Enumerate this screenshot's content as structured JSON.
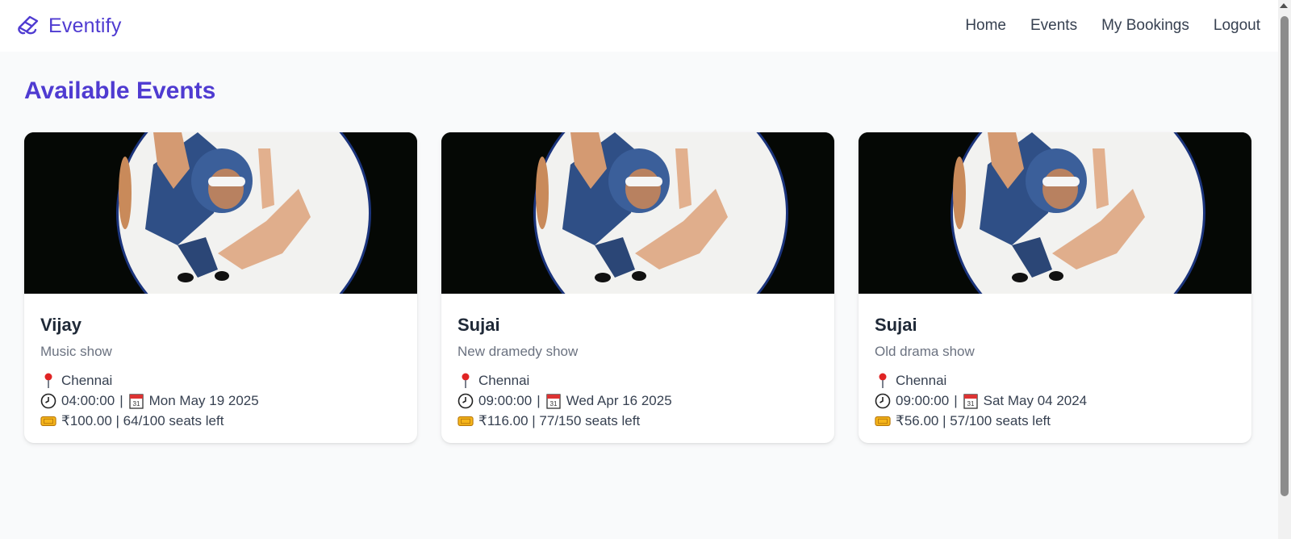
{
  "brand": {
    "name": "Eventify",
    "icon": "ticket-icon"
  },
  "nav": {
    "links": [
      "Home",
      "Events",
      "My Bookings",
      "Logout"
    ]
  },
  "page": {
    "title": "Available Events"
  },
  "events": [
    {
      "title": "Vijay",
      "description": "Music show",
      "location": "Chennai",
      "time": "04:00:00",
      "date": "Mon May 19 2025",
      "price_seats": "₹100.00 | 64/100 seats left"
    },
    {
      "title": "Sujai",
      "description": "New dramedy show",
      "location": "Chennai",
      "time": "09:00:00",
      "date": "Wed Apr 16 2025",
      "price_seats": "₹116.00 | 77/150 seats left"
    },
    {
      "title": "Sujai",
      "description": "Old drama show",
      "location": "Chennai",
      "time": "09:00:00",
      "date": "Sat May 04 2024",
      "price_seats": "₹56.00 | 57/100 seats left"
    }
  ],
  "colors": {
    "accent": "#4f3bd1",
    "background": "#f9fafb",
    "card_image_bg": "#050805"
  }
}
